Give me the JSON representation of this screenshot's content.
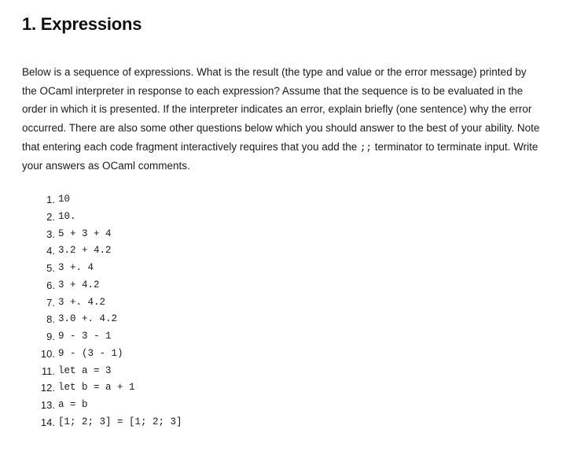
{
  "heading": "1. Expressions",
  "intro_parts": {
    "p1": "Below is a sequence of expressions. What is the result (the type and value or the error message) printed by the OCaml interpreter in response to each expression? Assume that the sequence is to be evaluated in the order in which it is presented. If the interpreter indicates an error, explain briefly (one sentence) why the error occurred. There are also some other questions below which you should answer to the best of your ability. Note that entering each code fragment interactively requires that you add the ",
    "code": ";;",
    "p2": " terminator to terminate input. Write your answers as OCaml comments."
  },
  "expressions": [
    "10",
    "10.",
    "5 + 3 + 4",
    "3.2 + 4.2",
    "3 +. 4",
    "3 + 4.2",
    "3 +. 4.2",
    "3.0 +. 4.2",
    "9 - 3 - 1",
    "9 - (3 - 1)",
    "let a = 3",
    "let b = a + 1",
    "a = b",
    "[1; 2; 3] = [1; 2; 3]"
  ]
}
